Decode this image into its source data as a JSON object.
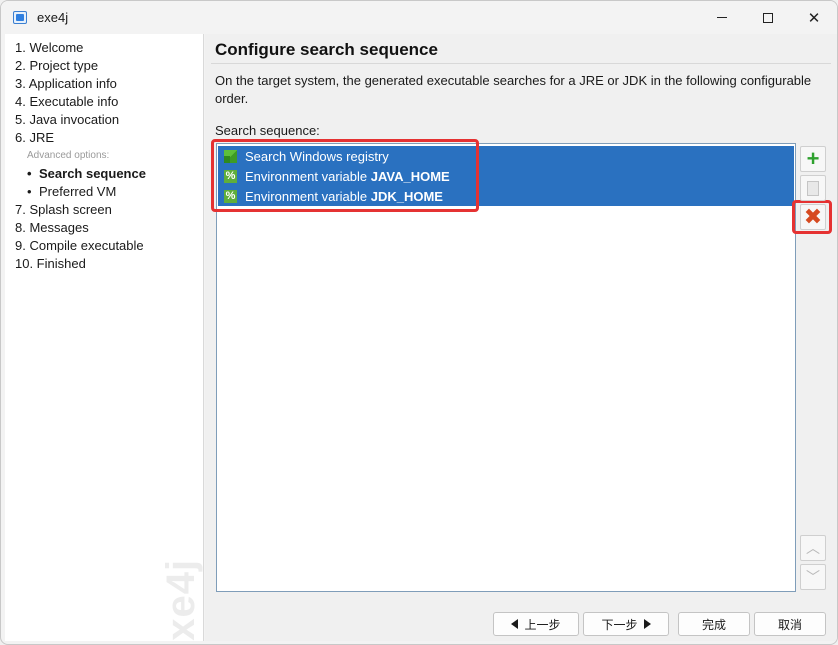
{
  "window": {
    "title": "exe4j",
    "minimize_label": "—",
    "maximize_label": "□",
    "close_label": "✕"
  },
  "sidebar": {
    "items": [
      {
        "label": "1. Welcome"
      },
      {
        "label": "2. Project type"
      },
      {
        "label": "3. Application info"
      },
      {
        "label": "4. Executable info"
      },
      {
        "label": "5. Java invocation"
      },
      {
        "label": "6. JRE"
      }
    ],
    "advanced_label": "Advanced options:",
    "sub_items": [
      {
        "label": "Search sequence",
        "active": true
      },
      {
        "label": "Preferred VM",
        "active": false
      }
    ],
    "items_after": [
      {
        "label": "7. Splash screen"
      },
      {
        "label": "8. Messages"
      },
      {
        "label": "9. Compile executable"
      },
      {
        "label": "10. Finished"
      }
    ],
    "watermark": "exe4j"
  },
  "main": {
    "title": "Configure search sequence",
    "description": "On the target system, the generated executable searches for a JRE or JDK in the following configurable order.",
    "sequence_label": "Search sequence:",
    "entries": [
      {
        "icon": "registry-icon",
        "text": "Search Windows registry",
        "bold": ""
      },
      {
        "icon": "environment-variable-icon",
        "text": "Environment variable ",
        "bold": "JAVA_HOME"
      },
      {
        "icon": "environment-variable-icon",
        "text": "Environment variable ",
        "bold": "JDK_HOME"
      }
    ],
    "side_buttons": {
      "add_icon": "plus-icon",
      "edit_icon": "edit-icon",
      "delete_icon": "delete-icon",
      "up_icon": "chevron-up-icon",
      "down_icon": "chevron-down-icon"
    },
    "highlight_color": "#e53232",
    "selection_color": "#2a71c0"
  },
  "footer": {
    "back_label": "上一步",
    "next_label": "下一步",
    "finish_label": "完成",
    "cancel_label": "取消"
  }
}
